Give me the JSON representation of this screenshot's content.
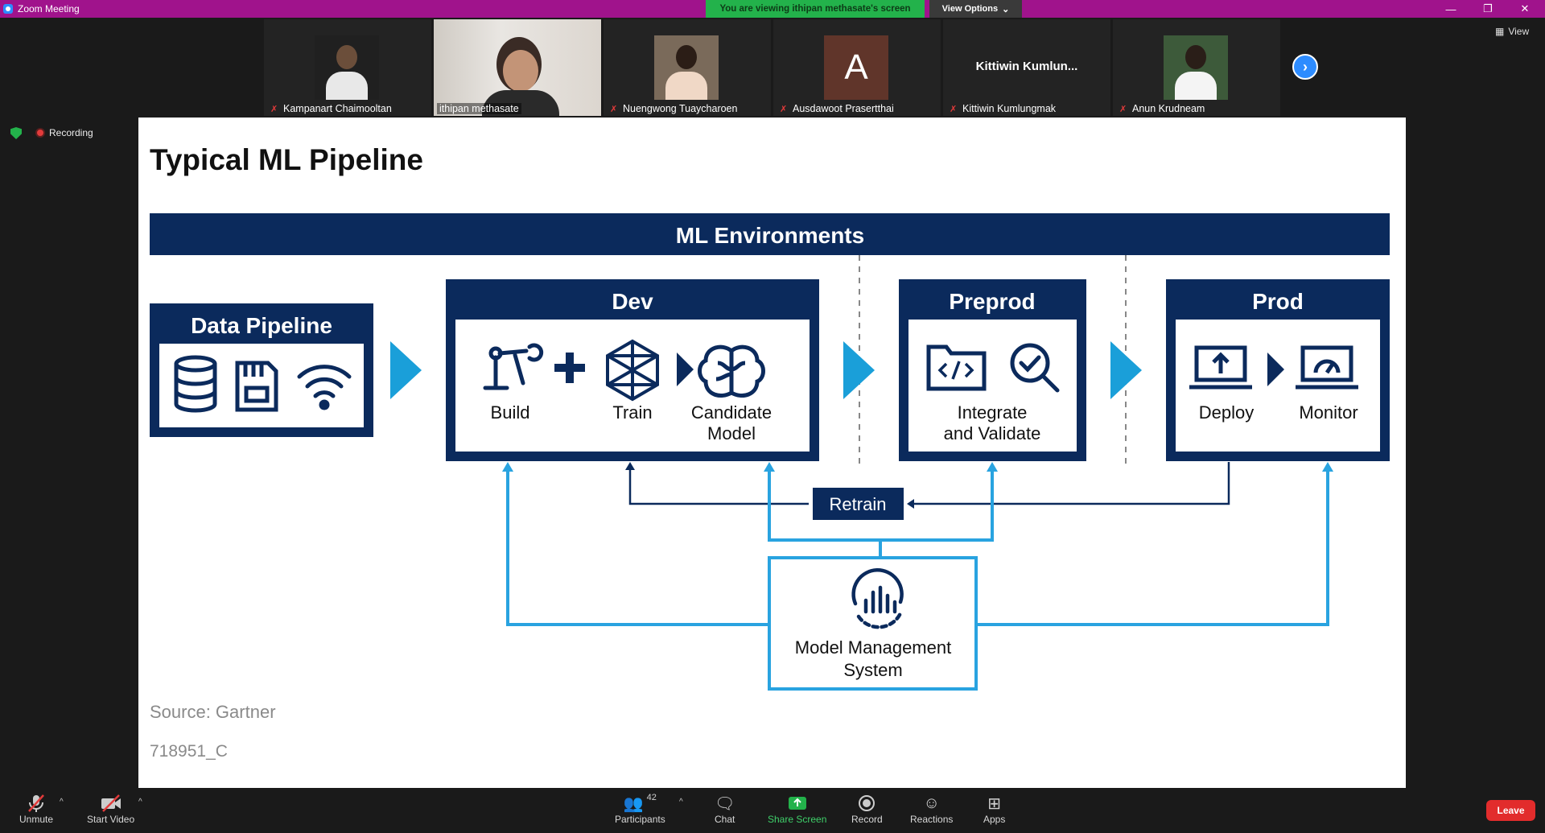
{
  "window": {
    "title": "Zoom Meeting",
    "controls": [
      "minimize",
      "restore",
      "close"
    ]
  },
  "share_banner": {
    "text": "You are viewing ithipan methasate's screen",
    "view_options_label": "View Options"
  },
  "participants_strip": [
    {
      "name": "Kampanart Chaimooltan",
      "muted": true,
      "type": "photo"
    },
    {
      "name": "ithipan methasate",
      "muted": false,
      "type": "video",
      "active_speaker": true
    },
    {
      "name": "Nuengwong Tuaycharoen",
      "muted": true,
      "type": "photo"
    },
    {
      "name": "Ausdawoot Prasertthai",
      "muted": true,
      "type": "avatar",
      "avatar_letter": "A"
    },
    {
      "name": "Kittiwin Kumlungmak",
      "muted": true,
      "type": "name",
      "display_name": "Kittiwin  Kumlun..."
    },
    {
      "name": "Anun Krudneam",
      "muted": true,
      "type": "photo"
    }
  ],
  "view_button_label": "View",
  "recording_label": "Recording",
  "slide": {
    "title": "Typical ML Pipeline",
    "banner": "ML Environments",
    "data_pipeline": {
      "title": "Data Pipeline"
    },
    "dev": {
      "title": "Dev",
      "build": "Build",
      "train": "Train",
      "candidate_line1": "Candidate",
      "candidate_line2": "Model"
    },
    "preprod": {
      "title": "Preprod",
      "line1": "Integrate",
      "line2": "and Validate"
    },
    "prod": {
      "title": "Prod",
      "deploy": "Deploy",
      "monitor": "Monitor"
    },
    "retrain": "Retrain",
    "mms_line1": "Model Management",
    "mms_line2": "System",
    "source": "Source: Gartner",
    "code": "718951_C",
    "colors": {
      "navy": "#0b2a5c",
      "blue": "#1a9fd9",
      "light_blue": "#29a3e0"
    }
  },
  "toolbar": {
    "unmute": "Unmute",
    "start_video": "Start Video",
    "participants": "Participants",
    "participants_count": "42",
    "chat": "Chat",
    "share_screen": "Share Screen",
    "record": "Record",
    "reactions": "Reactions",
    "apps": "Apps",
    "leave": "Leave"
  }
}
